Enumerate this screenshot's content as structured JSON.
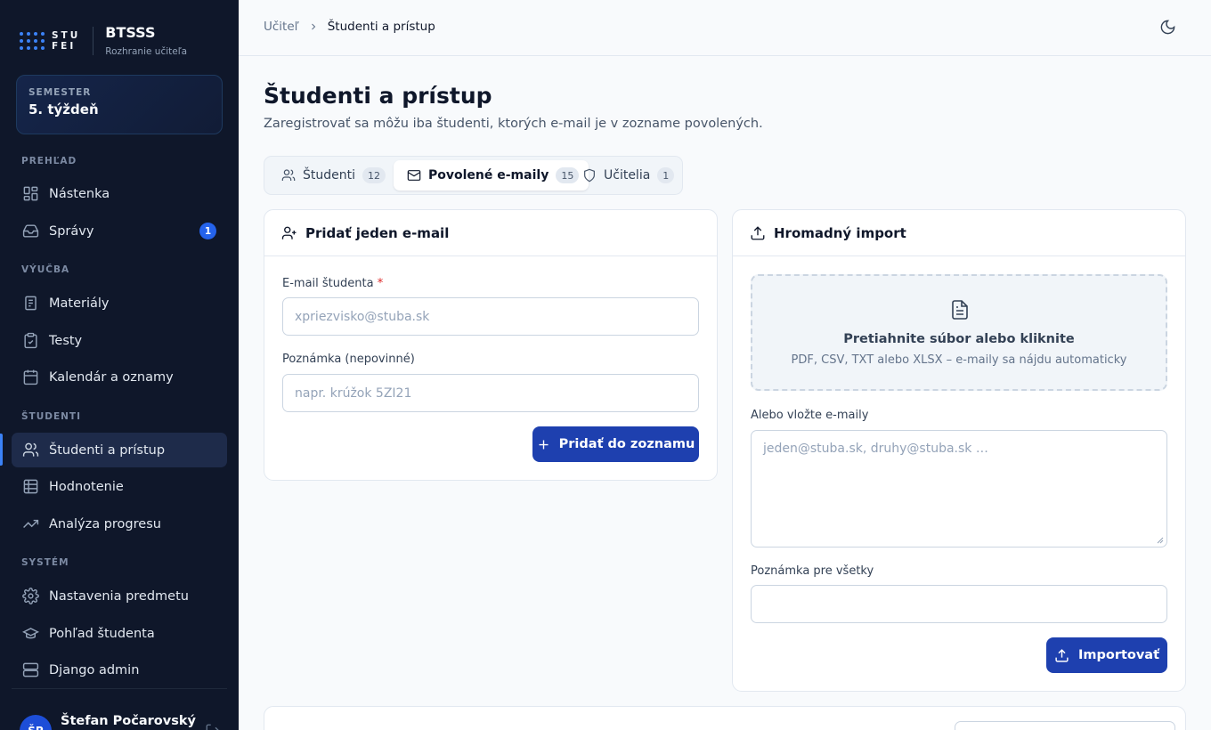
{
  "brand": {
    "logo_text_1": "STU",
    "logo_text_2": "FEI",
    "app_name": "BTSSS",
    "app_subtitle": "Rozhranie učiteľa"
  },
  "semester": {
    "label": "SEMESTER",
    "value": "5. týždeň"
  },
  "sidebar": {
    "sections": [
      "PREHĽAD",
      "VÝUČBA",
      "ŠTUDENTI",
      "SYSTÉM"
    ],
    "items": [
      {
        "label": "Nástenka",
        "icon": "layout-grid-icon"
      },
      {
        "label": "Správy",
        "icon": "inbox-icon",
        "badge": "1"
      },
      {
        "label": "Materiály",
        "icon": "book-icon"
      },
      {
        "label": "Testy",
        "icon": "clipboard-check-icon"
      },
      {
        "label": "Kalendár a oznamy",
        "icon": "calendar-icon"
      },
      {
        "label": "Študenti a prístup",
        "icon": "users-icon",
        "active": true
      },
      {
        "label": "Hodnotenie",
        "icon": "table-icon"
      },
      {
        "label": "Analýza progresu",
        "icon": "trending-up-icon"
      },
      {
        "label": "Nastavenia predmetu",
        "icon": "gear-icon"
      },
      {
        "label": "Pohľad študenta",
        "icon": "graduation-cap-icon"
      },
      {
        "label": "Django admin",
        "icon": "server-icon"
      }
    ]
  },
  "user": {
    "initials": "ŠP",
    "name": "Štefan Počarovský"
  },
  "breadcrumb": {
    "parent": "Učiteľ",
    "current": "Študenti a prístup"
  },
  "page": {
    "title": "Študenti a prístup",
    "description": "Zaregistrovať sa môžu iba študenti, ktorých e-mail je v zozname povolených."
  },
  "tabs": [
    {
      "label": "Študenti",
      "count": "12"
    },
    {
      "label": "Povolené e-maily",
      "count": "15",
      "active": true
    },
    {
      "label": "Učitelia",
      "count": "1"
    }
  ],
  "add_card": {
    "title": "Pridať jeden e-mail",
    "email_label": "E-mail študenta",
    "required_mark": "*",
    "email_placeholder": "xpriezvisko@stuba.sk",
    "note_label": "Poznámka (nepovinné)",
    "note_placeholder": "napr. krúžok 5ZI21",
    "submit_label": "Pridať do zoznamu"
  },
  "import_card": {
    "title": "Hromadný import",
    "dropzone_title": "Pretiahnite súbor alebo kliknite",
    "dropzone_subtitle": "PDF, CSV, TXT alebo XLSX – e-maily sa nájdu automaticky",
    "paste_label": "Alebo vložte e-maily",
    "paste_placeholder": "jeden@stuba.sk, druhy@stuba.sk …",
    "note_label": "Poznámka pre všetky",
    "note_value": "",
    "submit_label": "Importovať"
  },
  "colors": {
    "sidebar_bg": "#0f172a",
    "accent": "#1e40af",
    "badge": "#2563eb"
  }
}
